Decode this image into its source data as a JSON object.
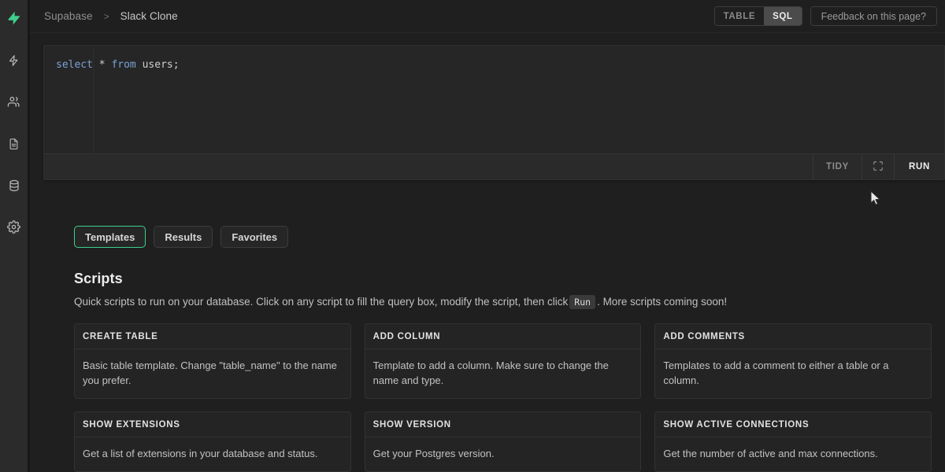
{
  "sidebar": {
    "logo": {
      "icon": "lightning-bolt-logo",
      "color": "#3ecf8e"
    },
    "items": [
      {
        "icon": "lightning-bolt-icon",
        "name": "sidebar-item-functions"
      },
      {
        "icon": "users-icon",
        "name": "sidebar-item-auth"
      },
      {
        "icon": "document-icon",
        "name": "sidebar-item-docs"
      },
      {
        "icon": "database-icon",
        "name": "sidebar-item-database"
      },
      {
        "icon": "gear-icon",
        "name": "sidebar-item-settings"
      }
    ]
  },
  "header": {
    "breadcrumb": {
      "root": "Supabase",
      "separator": ">",
      "current": "Slack Clone"
    },
    "view_toggle": {
      "options": [
        "TABLE",
        "SQL"
      ],
      "selected": "SQL"
    },
    "feedback_label": "Feedback on this page?"
  },
  "editor": {
    "query": "select * from users;",
    "tokens": [
      {
        "text": "select",
        "type": "keyword"
      },
      {
        "text": " * ",
        "type": "plain"
      },
      {
        "text": "from",
        "type": "keyword"
      },
      {
        "text": " users;",
        "type": "plain"
      }
    ],
    "toolbar": {
      "tidy_label": "TIDY",
      "fullscreen_icon": "expand-icon",
      "run_label": "RUN"
    }
  },
  "tabs": [
    {
      "label": "Templates",
      "active": true
    },
    {
      "label": "Results",
      "active": false
    },
    {
      "label": "Favorites",
      "active": false
    }
  ],
  "scripts": {
    "title": "Scripts",
    "description_before": "Quick scripts to run on your database. Click on any script to fill the query box, modify the script, then click",
    "description_chip": "Run",
    "description_after": ". More scripts coming soon!",
    "cards": [
      {
        "title": "CREATE TABLE",
        "description": "Basic table template. Change \"table_name\" to the name you prefer.",
        "two_line": true
      },
      {
        "title": "ADD COLUMN",
        "description": "Template to add a column. Make sure to change the name and type.",
        "two_line": true
      },
      {
        "title": "ADD COMMENTS",
        "description": "Templates to add a comment to either a table or a column.",
        "two_line": true
      },
      {
        "title": "SHOW EXTENSIONS",
        "description": "Get a list of extensions in your database and status.",
        "two_line": false
      },
      {
        "title": "SHOW VERSION",
        "description": "Get your Postgres version.",
        "two_line": false
      },
      {
        "title": "SHOW ACTIVE CONNECTIONS",
        "description": "Get the number of active and max connections.",
        "two_line": false
      }
    ]
  },
  "theme": {
    "accent_green": "#3ecf8e",
    "background": "#1f1f1f",
    "panel": "#262626",
    "keyword_blue": "#7aa2d6"
  }
}
